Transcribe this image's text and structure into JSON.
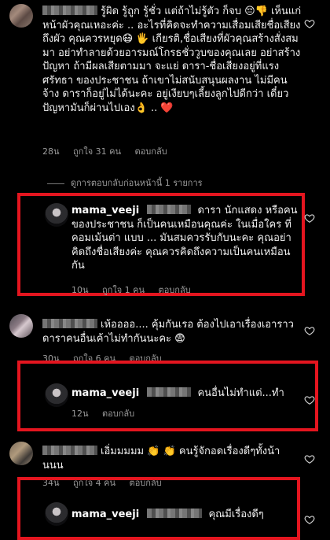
{
  "comments": [
    {
      "text": "รู้ผิด รู้ถูก รู้ชั่ว แต่ถ้าไม่รู้ตัว ก็จบ 😔👎 เห็นแก่หน้าผัวคุณเหอะค่ะ .. อะไรที่คิดจะทำความเสื่อมเสียชื่อเสียงถึงผัว คุณควรหยุด😷 🖐 เกียรติ,ชื่อเสียงที่ผัวคุณสร้างสั่งสมมา อย่าทำลายด้วยอารมณ์โกรธชั่ววูบของคุณเลย อย่าสร้างปัญหา ถ้ามีผลเสียตามมา จะแย่ ดารา-ชื่อเสียงอยู่ที่แรงศรัทธา ของประชาชน ถ้าเขาไม่สนับสนุนผลงาน ไม่มีคนจ้าง ดาราก็อยู่ไม่ได้นะคะ อยู่เงียบๆเลี้ยงลูกไปดีกว่า เดี๋ยวปัญหามันก็ผ่านไปเอง👌 .. ❤️",
      "time": "28น",
      "likes": "ถูกใจ 31 คน",
      "reply": "ตอบกลับ"
    },
    {
      "view_replies": "ดูการตอบกลับก่อนหน้านี้ 1 รายการ"
    },
    {
      "username": "mama_veeji",
      "text": "ดารา นักแสดง หรือคนของประชาชน ก็เป็นคนเหมือนคุณค่ะ ในเมื่อใคร ที่คอมเม้นต่า แบบ ... มันสมควรรับกับนะคะ คุณอย่าคิดถึงชื่อเสียงค่ะ คุณควรคิดถึงความเป็นคนเหมือนกัน",
      "time": "10น",
      "likes": "ถูกใจ 1 คน",
      "reply": "ตอบกลับ"
    },
    {
      "text": "เห้ออออ.... คุ้มกันเรอ ต้องไปเอาเรื่องเอาราวดาราคนอื่นเค้าไม่ทำกันนะคะ 😨",
      "time": "30น",
      "likes": "ถูกใจ 6 คน",
      "reply": "ตอบกลับ"
    },
    {
      "username": "mama_veeji",
      "text": "คนอื่นไม่ทำแต่...ทำ",
      "time": "12น",
      "reply": "ตอบกลับ"
    },
    {
      "text": "เอิ่มมมมม 👏 👏 คนรู้จักอดเรื่องดีๆทั้งน้านนน",
      "time": "34น",
      "likes": "ถูกใจ 4 คน",
      "reply": "ตอบกลับ"
    },
    {
      "username": "mama_veeji",
      "text": "คุณมีเรื่องดีๆ"
    }
  ],
  "colors": {
    "highlight": "#e4151f",
    "background": "#000000",
    "muted": "#9b9b9b"
  },
  "icons": {
    "like": "heart-outline-icon"
  }
}
